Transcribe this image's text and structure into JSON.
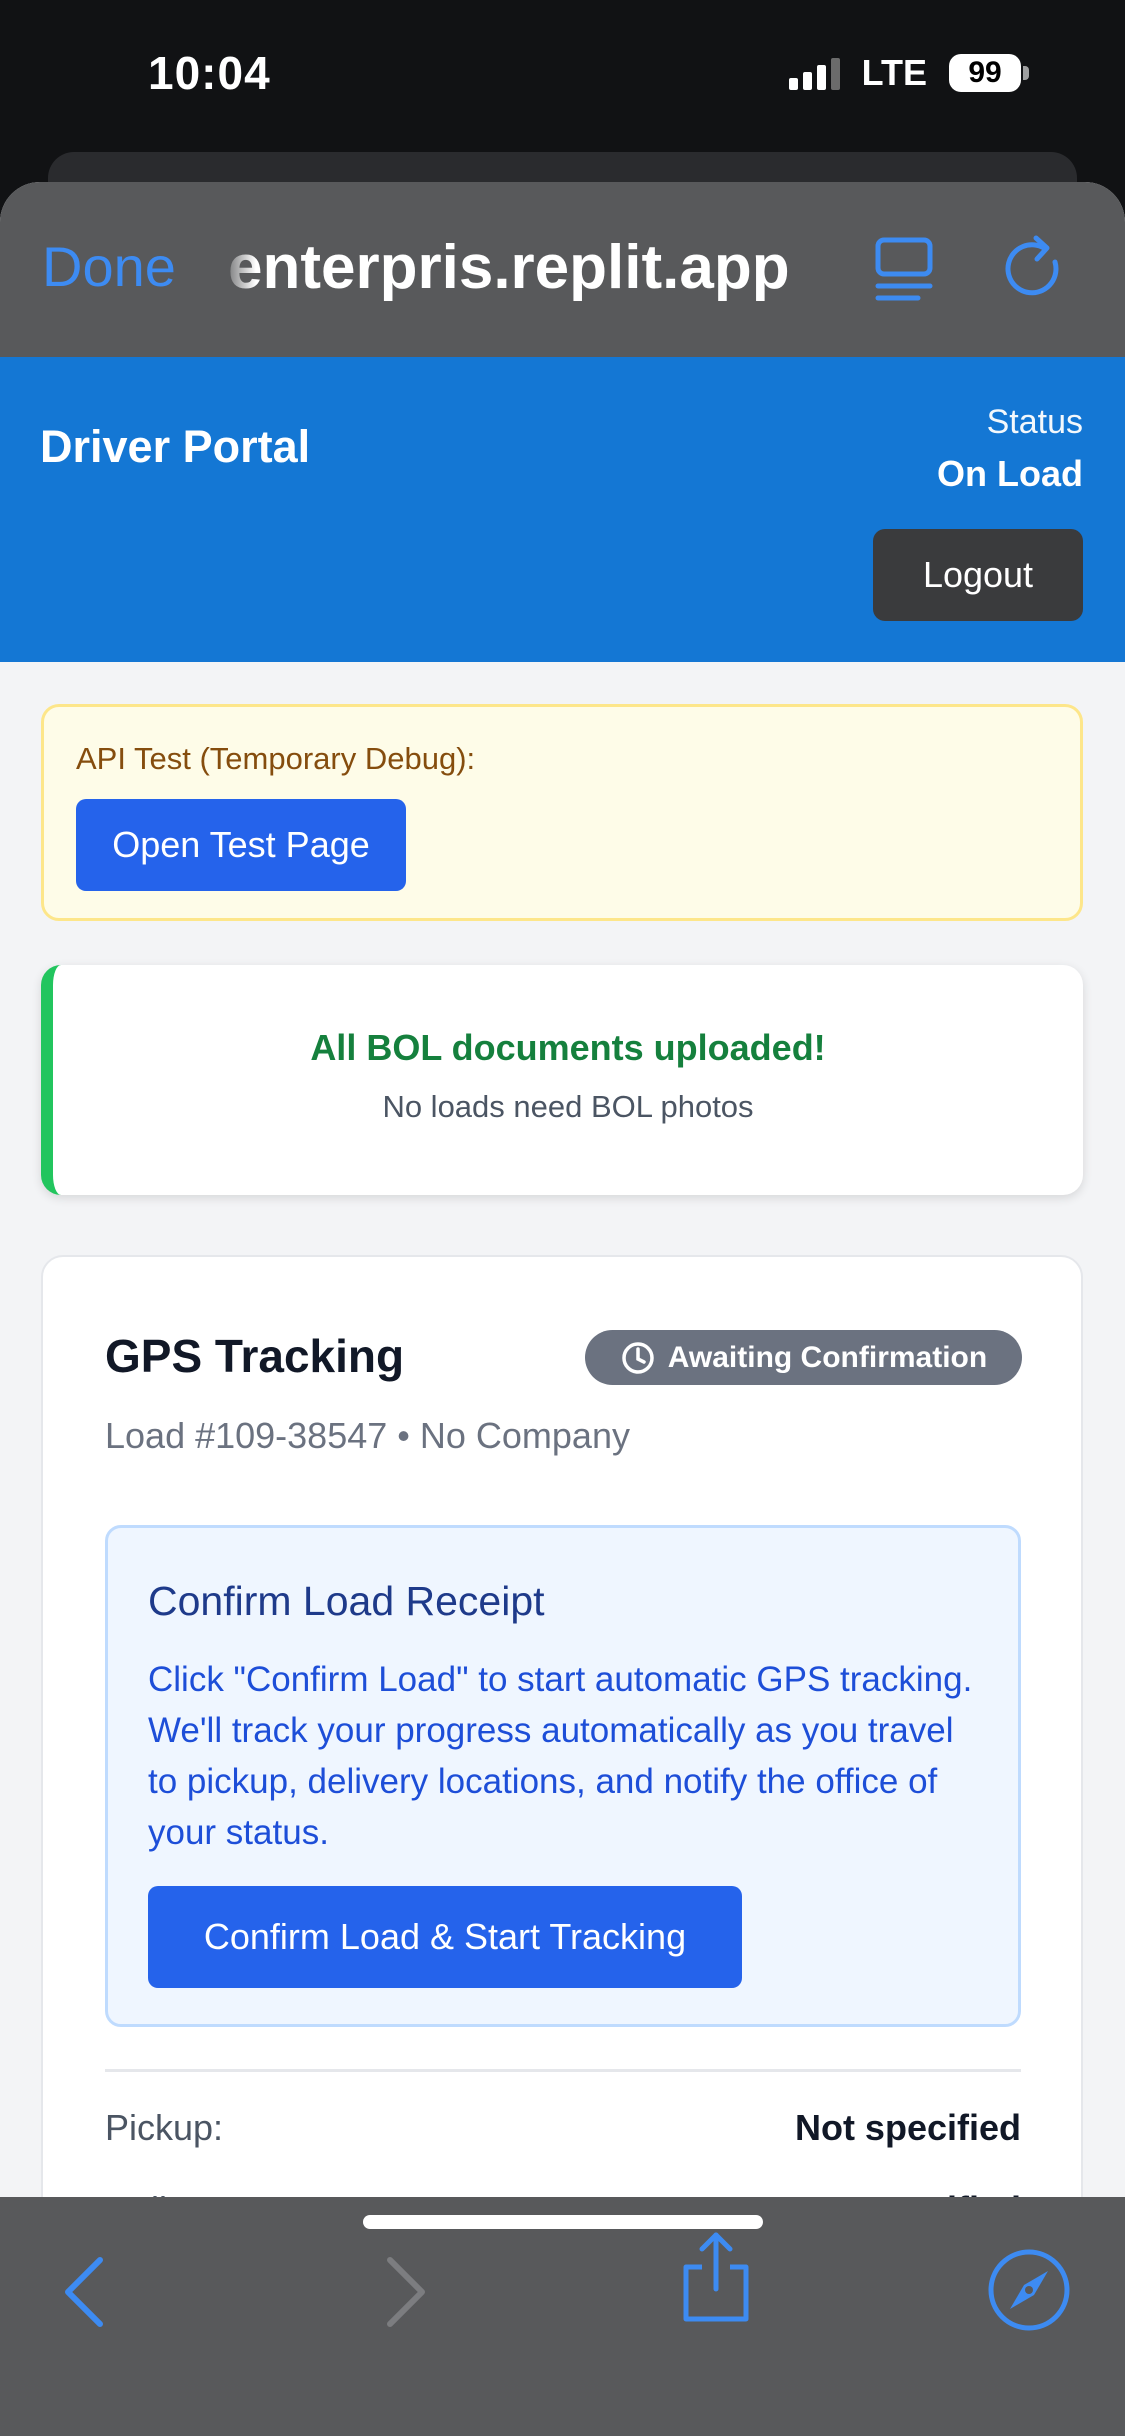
{
  "status_bar": {
    "time": "10:04",
    "network": "LTE",
    "battery": "99"
  },
  "browser": {
    "done_label": "Done",
    "url": "enterpris.replit.app"
  },
  "app": {
    "title": "Driver Portal",
    "status_label": "Status",
    "status_value": "On Load",
    "logout_label": "Logout"
  },
  "debug": {
    "label": "API Test (Temporary Debug):",
    "button_label": "Open Test Page"
  },
  "bol": {
    "title": "All BOL documents uploaded!",
    "subtitle": "No loads need BOL photos"
  },
  "gps": {
    "title": "GPS Tracking",
    "badge": "Awaiting Confirmation",
    "load_line": "Load #109-38547 • No Company",
    "confirm_title": "Confirm Load Receipt",
    "confirm_text": "Click \"Confirm Load\" to start automatic GPS tracking. We'll track your progress automatically as you travel to pickup, delivery locations, and notify the office of your status.",
    "confirm_button": "Confirm Load & Start Tracking",
    "details": [
      {
        "label": "Pickup:",
        "value": "Not specified"
      },
      {
        "label": "Delivery:",
        "value": "Not specified"
      }
    ]
  },
  "colors": {
    "header_blue": "#1477d4",
    "primary_button": "#2563eb",
    "ios_blue": "#3d8bf2",
    "success_green": "#15803d"
  }
}
